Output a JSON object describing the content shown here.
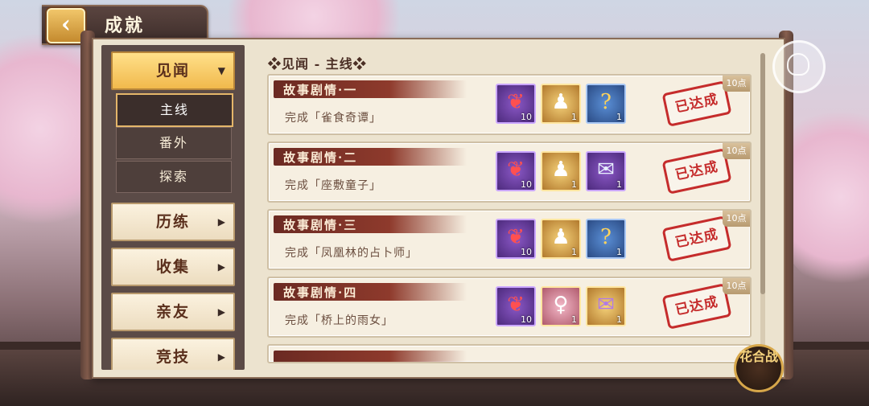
{
  "header": {
    "back_icon": "‹",
    "title": "成就"
  },
  "sidebar": {
    "categories": [
      {
        "label": "见闻",
        "arrow": "▼",
        "active": true
      },
      {
        "label": "历练",
        "arrow": "▶"
      },
      {
        "label": "收集",
        "arrow": "▶"
      },
      {
        "label": "亲友",
        "arrow": "▶"
      },
      {
        "label": "竞技",
        "arrow": "▶"
      }
    ],
    "subitems": [
      {
        "label": "主线",
        "active": true
      },
      {
        "label": "番外"
      },
      {
        "label": "探索"
      }
    ]
  },
  "content": {
    "section_title": "❖见闻 - 主线❖",
    "status_stamp": "已达成",
    "achievements": [
      {
        "title": "故事剧情·一",
        "desc": "完成「雀食奇谭」",
        "points": "10点",
        "rewards": [
          {
            "icon": "red-magatama-icon",
            "qty": "10"
          },
          {
            "icon": "shikigami-portrait-icon",
            "qty": "1"
          },
          {
            "icon": "mystery-bag-icon",
            "qty": "1"
          }
        ]
      },
      {
        "title": "故事剧情·二",
        "desc": "完成「座敷童子」",
        "points": "10点",
        "rewards": [
          {
            "icon": "red-magatama-icon",
            "qty": "10"
          },
          {
            "icon": "shikigami-portrait-icon",
            "qty": "1"
          },
          {
            "icon": "scroll-icon",
            "qty": "1"
          }
        ]
      },
      {
        "title": "故事剧情·三",
        "desc": "完成「凤凰林的占卜师」",
        "points": "10点",
        "rewards": [
          {
            "icon": "red-magatama-icon",
            "qty": "10"
          },
          {
            "icon": "shikigami-portrait-icon",
            "qty": "1"
          },
          {
            "icon": "mystery-bag-icon",
            "qty": "1"
          }
        ]
      },
      {
        "title": "故事剧情·四",
        "desc": "完成「桥上的雨女」",
        "points": "10点",
        "rewards": [
          {
            "icon": "red-magatama-icon",
            "qty": "10"
          },
          {
            "icon": "ame-onna-portrait-icon",
            "qty": "1"
          },
          {
            "icon": "purple-scroll-icon",
            "qty": "1"
          }
        ]
      }
    ]
  },
  "badge": {
    "text": "花合战"
  }
}
